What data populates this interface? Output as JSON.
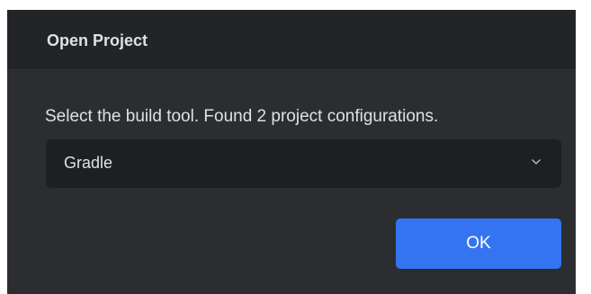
{
  "dialog": {
    "title": "Open Project",
    "message": "Select the build tool. Found 2 project configurations.",
    "build_tool_select": {
      "selected": "Gradle",
      "icon": "chevron-down-icon"
    },
    "ok_label": "OK"
  },
  "colors": {
    "dialog_background": "#2b2d30",
    "title_bar_background": "#232427",
    "select_background": "#1e1f22",
    "text": "#dfe1e5",
    "accent": "#3574f0"
  }
}
